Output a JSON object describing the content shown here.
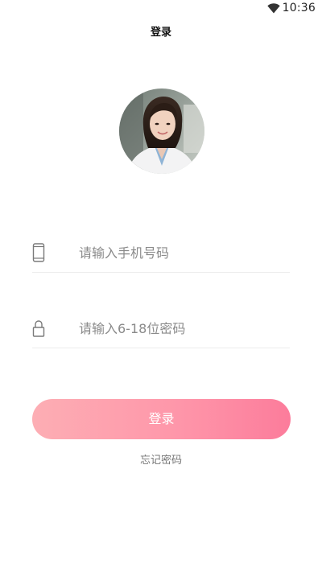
{
  "status_bar": {
    "time": "10:36",
    "wifi_icon": "wifi-icon"
  },
  "header": {
    "title": "登录"
  },
  "avatar": {
    "icon": "avatar-photo"
  },
  "form": {
    "phone": {
      "icon": "phone-icon",
      "value": "",
      "placeholder": "请输入手机号码"
    },
    "password": {
      "icon": "lock-icon",
      "value": "",
      "placeholder": "请输入6-18位密码"
    },
    "submit_label": "登录",
    "forgot_label": "忘记密码"
  },
  "colors": {
    "button_gradient_start": "#fdaeb4",
    "button_gradient_end": "#fc7c9b",
    "divider": "#ececec",
    "placeholder": "#8a8a8a"
  }
}
